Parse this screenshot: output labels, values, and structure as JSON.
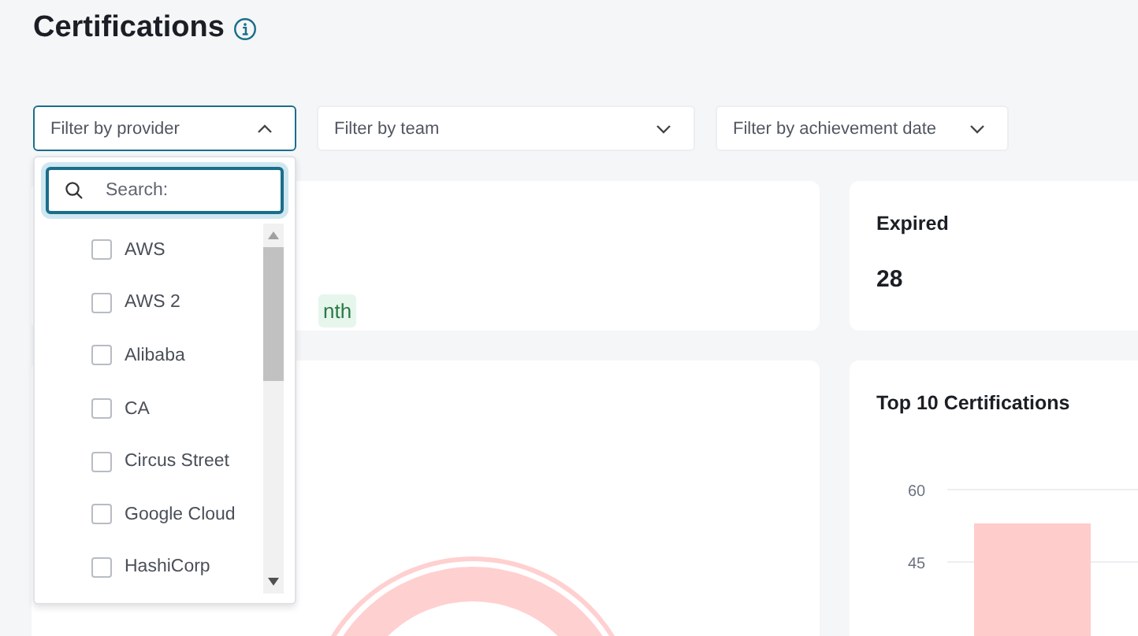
{
  "page": {
    "title": "Certifications"
  },
  "filters": [
    {
      "placeholder": "Filter by provider",
      "expanded": true
    },
    {
      "placeholder": "Filter by team",
      "expanded": false
    },
    {
      "placeholder": "Filter by achievement date",
      "expanded": false
    }
  ],
  "provider_dropdown": {
    "search": {
      "placeholder": "Search:"
    },
    "options": [
      {
        "label": "AWS",
        "checked": false
      },
      {
        "label": "AWS 2",
        "checked": false
      },
      {
        "label": "Alibaba",
        "checked": false
      },
      {
        "label": "CA",
        "checked": false
      },
      {
        "label": "Circus Street",
        "checked": false
      },
      {
        "label": "Google Cloud",
        "checked": false
      },
      {
        "label": "HashiCorp",
        "checked": false
      }
    ]
  },
  "summary_cards": [
    {
      "badge": "nth"
    },
    {
      "title": "Expired",
      "value": "28"
    }
  ],
  "top_certifications": {
    "title": "Top 10 Certifications",
    "chart_data": {
      "type": "bar",
      "yticks": [
        45,
        60
      ],
      "ylim": [
        0,
        60
      ],
      "values": [
        53
      ]
    }
  }
}
